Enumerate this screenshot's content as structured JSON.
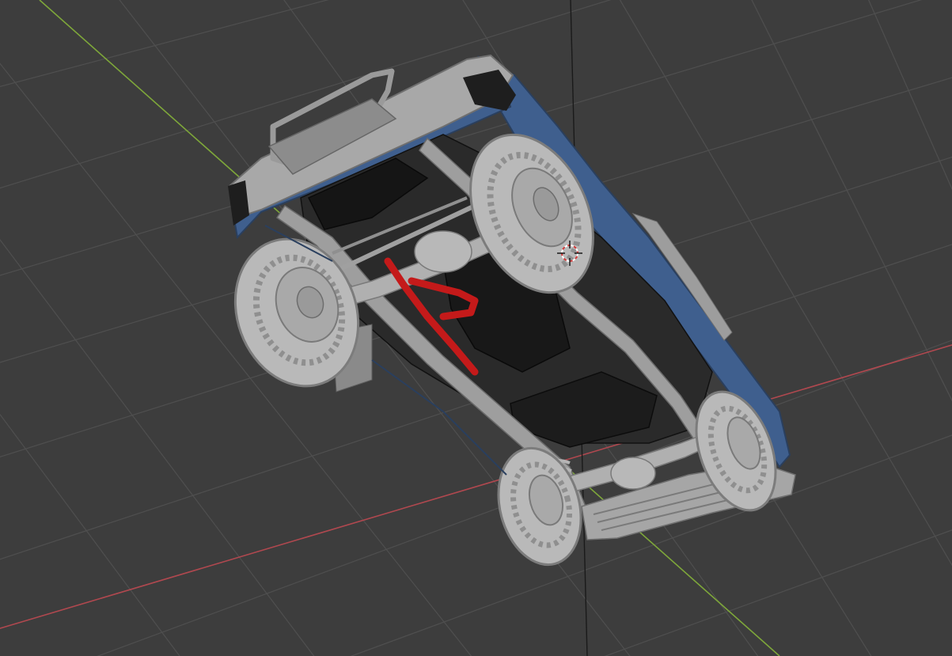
{
  "viewport": {
    "background": "#3d3d3d",
    "grid_color": "#4f4f4f",
    "grid_highlight": "#5a5a5a"
  },
  "axes": {
    "x_color": "#b0484f",
    "y_color": "#7ea73a",
    "z_color": "#1a1a1a"
  },
  "model": {
    "body_color": "#3f5f8e",
    "chassis_color": "#a8a8a8",
    "tire_color": "#b9b9b9",
    "dark_color": "#1b1b1b",
    "accent_color": "#c41a1a"
  },
  "cursor": {
    "icon": "3d-cursor-icon",
    "color_a": "#ffffff",
    "color_b": "#d23a3a"
  }
}
